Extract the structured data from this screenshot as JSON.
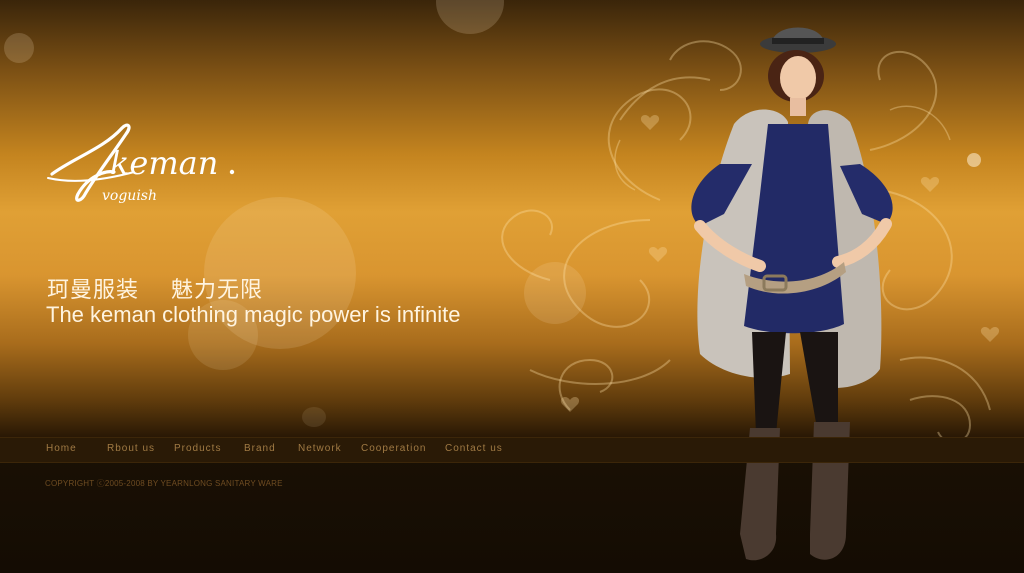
{
  "brand": {
    "logo_text": "keman",
    "logo_tagline": "voguish"
  },
  "hero": {
    "headline_cn": "珂曼服装    魅力无限",
    "headline_en": "The keman clothing magic power is infinite"
  },
  "nav": {
    "items": [
      {
        "label": "Home"
      },
      {
        "label": "Rbout us"
      },
      {
        "label": "Products"
      },
      {
        "label": "Brand"
      },
      {
        "label": "Network"
      },
      {
        "label": "Cooperation"
      },
      {
        "label": "Contact us"
      }
    ]
  },
  "footer": {
    "copyright": "COPYRIGHT ⓒ2005-2008 BY YEARNLONG SANITARY WARE"
  },
  "colors": {
    "background_gold": "#e0a035",
    "nav_bar": "#2a1a06",
    "nav_text": "#a07a44",
    "headline_text": "#fff4e0"
  },
  "images": {
    "hero_model": "woman-in-fur-vest-photo"
  }
}
